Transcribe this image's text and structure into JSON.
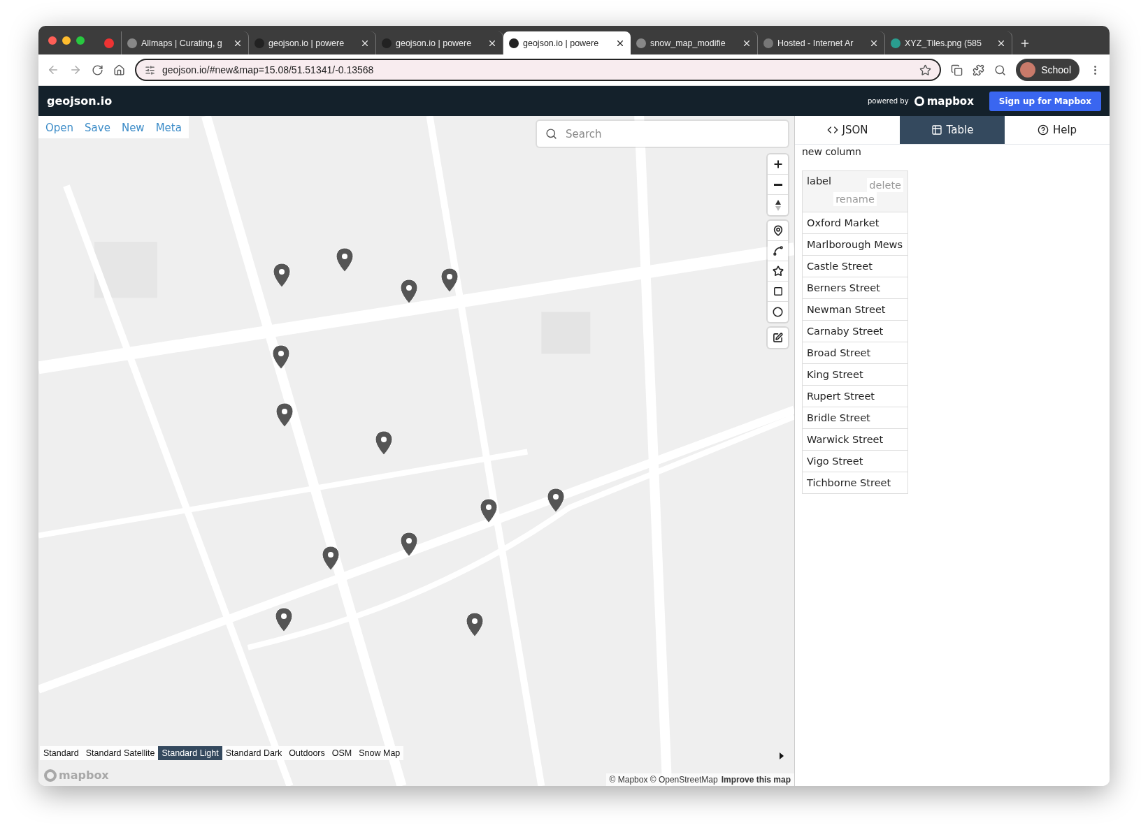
{
  "browser": {
    "tabs": [
      {
        "kind": "pinned",
        "selected": false
      },
      {
        "kind": "page",
        "title": "Allmaps | Curating, g",
        "selected": false
      },
      {
        "kind": "page",
        "title": "geojson.io | powere",
        "selected": false
      },
      {
        "kind": "page",
        "title": "geojson.io | powere",
        "selected": false
      },
      {
        "kind": "page",
        "title": "geojson.io | powere",
        "selected": true
      },
      {
        "kind": "page",
        "title": "snow_map_modifie",
        "selected": false
      },
      {
        "kind": "page",
        "title": "Hosted - Internet Ar",
        "selected": false
      },
      {
        "kind": "page",
        "title": "XYZ_Tiles.png (585",
        "selected": false
      }
    ],
    "address": "geojson.io/#new&map=15.08/51.51341/-0.13568",
    "profile": "School"
  },
  "header": {
    "title": "geojson.io",
    "powered_by": "powered by",
    "logo_text": "mapbox",
    "signup": "Sign up for Mapbox"
  },
  "menu": [
    "Open",
    "Save",
    "New",
    "Meta"
  ],
  "search": {
    "placeholder": "Search"
  },
  "layers": [
    {
      "label": "Standard",
      "selected": false
    },
    {
      "label": "Standard Satellite",
      "selected": false
    },
    {
      "label": "Standard Light",
      "selected": true
    },
    {
      "label": "Standard Dark",
      "selected": false
    },
    {
      "label": "Outdoors",
      "selected": false
    },
    {
      "label": "OSM",
      "selected": false
    },
    {
      "label": "Snow Map",
      "selected": false
    }
  ],
  "map_logo": "mapbox",
  "attribution": {
    "text": "© Mapbox © OpenStreetMap",
    "link": "Improve this map"
  },
  "panel": {
    "tabs": [
      {
        "label": "JSON",
        "selected": false
      },
      {
        "label": "Table",
        "selected": true
      },
      {
        "label": "Help",
        "selected": false
      }
    ],
    "new_column": "new column",
    "table": {
      "column": "label",
      "delete": "delete",
      "rename": "rename",
      "rows": [
        "Oxford Market",
        "Marlborough Mews",
        "Castle Street",
        "Berners Street",
        "Newman Street",
        "Carnaby Street",
        "Broad Street",
        "King Street",
        "Rupert Street",
        "Bridle Street",
        "Warwick Street",
        "Vigo Street",
        "Tichborne Street"
      ]
    }
  }
}
